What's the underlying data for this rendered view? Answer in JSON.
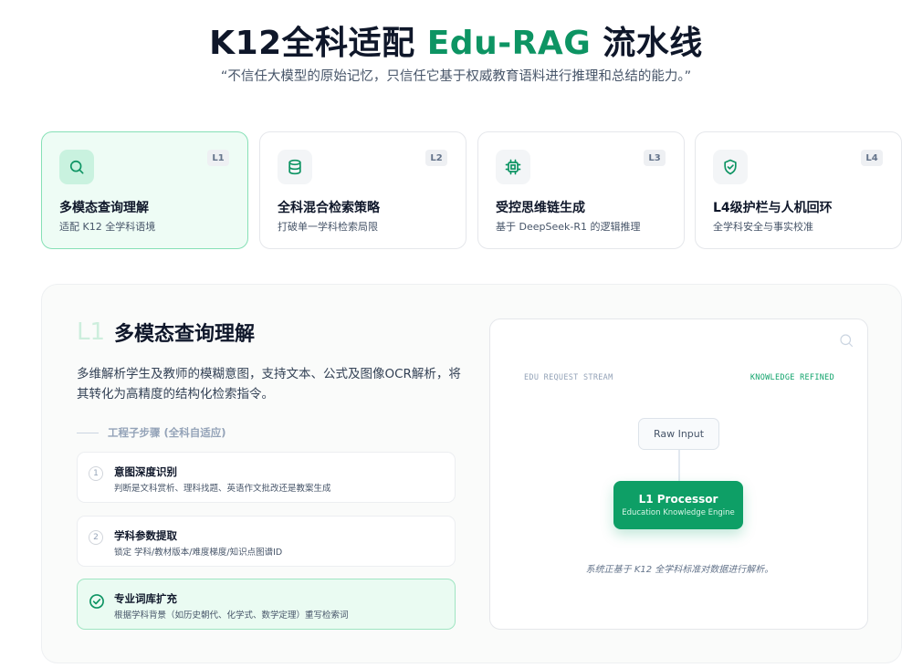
{
  "header": {
    "title_prefix": "K12全科适配 ",
    "title_accent": "Edu-RAG",
    "title_suffix": " 流水线",
    "subtitle": "“不信任大模型的原始记忆，只信任它基于权威教育语料进行推理和总结的能力。”"
  },
  "cards": [
    {
      "badge": "L1",
      "title": "多模态查询理解",
      "subtitle": "适配 K12 全学科语境",
      "icon": "search-icon",
      "active": true
    },
    {
      "badge": "L2",
      "title": "全科混合检索策略",
      "subtitle": "打破单一学科检索局限",
      "icon": "database-icon",
      "active": false
    },
    {
      "badge": "L3",
      "title": "受控思维链生成",
      "subtitle": "基于 DeepSeek-R1 的逻辑推理",
      "icon": "cpu-icon",
      "active": false
    },
    {
      "badge": "L4",
      "title": "L4级护栏与人机回环",
      "subtitle": "全学科安全与事实校准",
      "icon": "shield-check-icon",
      "active": false
    }
  ],
  "detail": {
    "level": "L1",
    "title": "多模态查询理解",
    "description": "多维解析学生及教师的模糊意图，支持文本、公式及图像OCR解析，将其转化为高精度的结构化检索指令。",
    "section_label": "工程子步骤 (全科自适应)",
    "steps": [
      {
        "num": "1",
        "title": "意图深度识别",
        "subtitle": "判断是文科赏析、理科找题、英语作文批改还是教案生成",
        "done": false
      },
      {
        "num": "2",
        "title": "学科参数提取",
        "subtitle": "锁定 学科/教材版本/难度梯度/知识点图谱ID",
        "done": false
      },
      {
        "num": "",
        "title": "专业词库扩充",
        "subtitle": "根据学科背景（如历史朝代、化学式、数学定理）重写检索词",
        "done": true
      }
    ]
  },
  "visual": {
    "left_label": "EDU REQUEST STREAM",
    "right_label": "KNOWLEDGE REFINED",
    "input_node": "Raw Input",
    "processor_title": "L1 Processor",
    "processor_subtitle": "Education Knowledge Engine",
    "footer": "系统正基于 K12 全学科标准对数据进行解析。"
  },
  "colors": {
    "accent": "#0d9463",
    "active_card_bg": "#eefcf5",
    "active_card_border": "#86e0b6",
    "processor_bg": "#0e9f66"
  }
}
